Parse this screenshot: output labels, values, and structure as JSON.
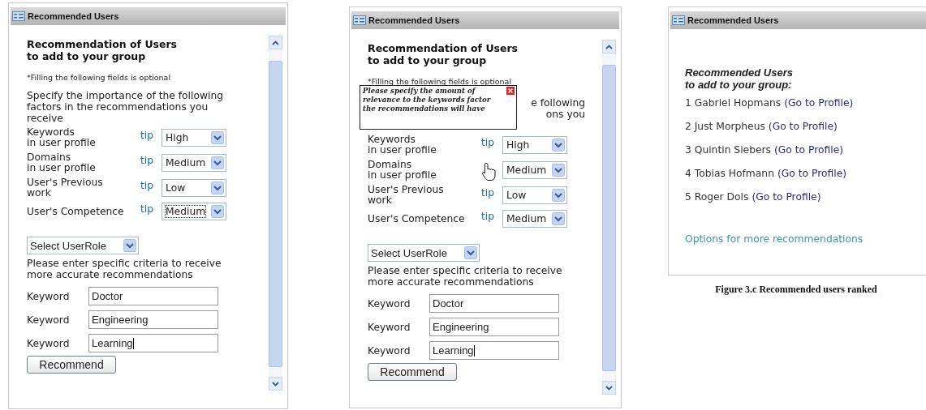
{
  "panels": [
    {
      "kind": "form",
      "header": "Recommended Users",
      "title_lines": [
        "Recommendation of Users",
        "to add to your group"
      ],
      "note": "*Filling the following fields is optional",
      "intro": "Specify the importance of the following factors in the recommendations you receive",
      "factors": [
        {
          "label_lines": [
            "Keywords",
            "in user profile"
          ],
          "tip": "tip",
          "value": "High",
          "focused": false,
          "cursor": false
        },
        {
          "label_lines": [
            "Domains",
            "in user profile"
          ],
          "tip": "tip",
          "value": "Medium",
          "focused": false,
          "cursor": false
        },
        {
          "label_lines": [
            "User's Previous",
            "work"
          ],
          "tip": "tip",
          "value": "Low",
          "focused": false,
          "cursor": false
        },
        {
          "label_lines": [
            "User's Competence"
          ],
          "tip": "tip",
          "value": "Medium",
          "focused": true,
          "cursor": false
        }
      ],
      "role_select": "Select UserRole",
      "criteria_text": "Please enter specific criteria to receive more accurate recommendations",
      "keywords": [
        {
          "label": "Keyword",
          "value": "Doctor",
          "focused": false
        },
        {
          "label": "Keyword",
          "value": "Engineering",
          "focused": false
        },
        {
          "label": "Keyword",
          "value": "Learning",
          "focused": true
        }
      ],
      "button": "Recommend"
    },
    {
      "kind": "form",
      "header": "Recommended Users",
      "title_lines": [
        "Recommendation of Users",
        "to add to your group"
      ],
      "note": "*Filling the following fields is optional",
      "intro_fragments": [
        "e following",
        "ons you"
      ],
      "tooltip": {
        "lines": [
          "Please specify the amount of",
          "relevance to the keywords factor",
          "the recommendations will have"
        ]
      },
      "factors": [
        {
          "label_lines": [
            "Keywords",
            "in user profile"
          ],
          "tip": "tip",
          "value": "High",
          "focused": false,
          "cursor": false
        },
        {
          "label_lines": [
            "Domains",
            "in user profile"
          ],
          "value": "Medium",
          "focused": false,
          "cursor": true
        },
        {
          "label_lines": [
            "User's Previous",
            "work"
          ],
          "tip": "tip",
          "value": "Low",
          "focused": false,
          "cursor": false
        },
        {
          "label_lines": [
            "User's Competence"
          ],
          "tip": "tip",
          "value": "Medium",
          "focused": false,
          "cursor": false
        }
      ],
      "role_select": "Select UserRole",
      "criteria_text": "Please enter specific criteria to receive more accurate recommendations",
      "keywords": [
        {
          "label": "Keyword",
          "value": "Doctor",
          "focused": false
        },
        {
          "label": "Keyword",
          "value": "Engineering",
          "focused": false
        },
        {
          "label": "Keyword",
          "value": "Learning",
          "focused": true
        }
      ],
      "button": "Recommend"
    },
    {
      "kind": "list",
      "header": "Recommended Users",
      "title_lines": [
        "Recommended Users",
        "to add to your group:"
      ],
      "items": [
        {
          "rank_name": "1 Gabriel Hopmans",
          "link": "(Go to Profile)"
        },
        {
          "rank_name": "2 Just Morpheus",
          "link": "(Go to Profile)"
        },
        {
          "rank_name": "3 Quintin Siebers",
          "link": "(Go to Profile)"
        },
        {
          "rank_name": "4 Tobias Hofmann",
          "link": "(Go to Profile)"
        },
        {
          "rank_name": "5 Roger Dols",
          "link": "(Go to Profile)"
        }
      ],
      "more_link": "Options for more recommendations",
      "caption": "Figure 3.c Recommended users ranked"
    }
  ]
}
